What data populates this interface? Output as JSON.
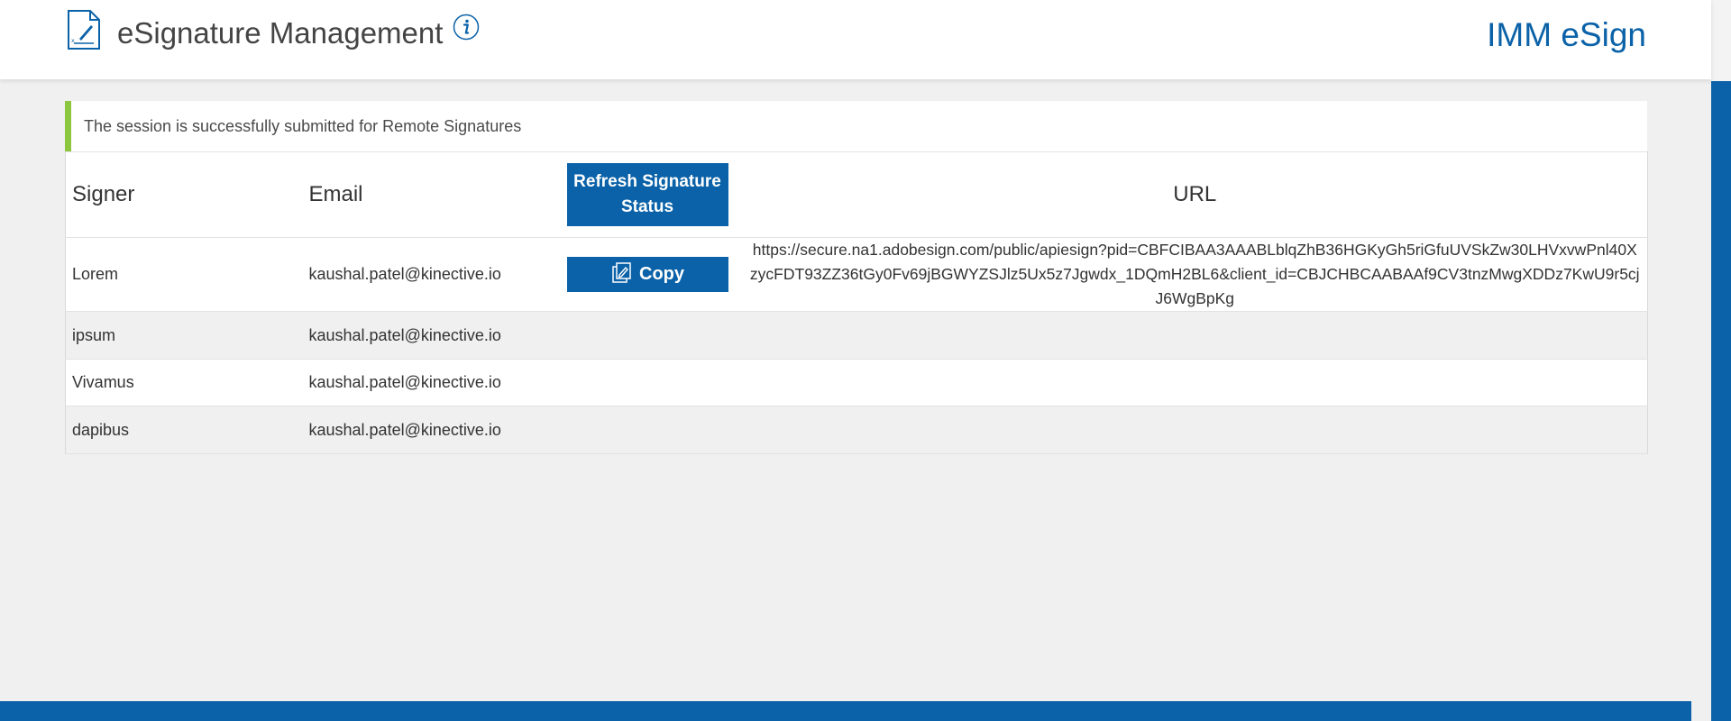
{
  "header": {
    "title": "eSignature Management",
    "brand": "IMM eSign",
    "doc_icon": "signed-document-icon",
    "info_icon": "info-icon"
  },
  "alert": {
    "message": "The session is successfully submitted for Remote Signatures",
    "accent_color": "#8cc63f"
  },
  "table": {
    "headers": {
      "signer": "Signer",
      "email": "Email",
      "url": "URL"
    },
    "refresh_button_label": "Refresh Signature Status",
    "copy_button_label": "Copy",
    "rows": [
      {
        "signer": "Lorem",
        "email": "kaushal.patel@kinective.io",
        "url": "https://secure.na1.adobesign.com/public/apiesign?pid=CBFCIBAA3AAABLblqZhB36HGKyGh5riGfuUVSkZw30LHVxvwPnl40XzycFDT93ZZ36tGy0Fv69jBGWYZSJlz5Ux5z7Jgwdx_1DQmH2BL6&client_id=CBJCHBCAABAAf9CV3tnzMwgXDDz7KwU9r5cjJ6WgBpKg"
      },
      {
        "signer": "ipsum",
        "email": "kaushal.patel@kinective.io",
        "url": ""
      },
      {
        "signer": "Vivamus",
        "email": "kaushal.patel@kinective.io",
        "url": ""
      },
      {
        "signer": "dapibus",
        "email": "kaushal.patel@kinective.io",
        "url": ""
      }
    ]
  },
  "colors": {
    "primary": "#0b62a8",
    "background": "#f0f0f0",
    "success": "#8cc63f"
  }
}
